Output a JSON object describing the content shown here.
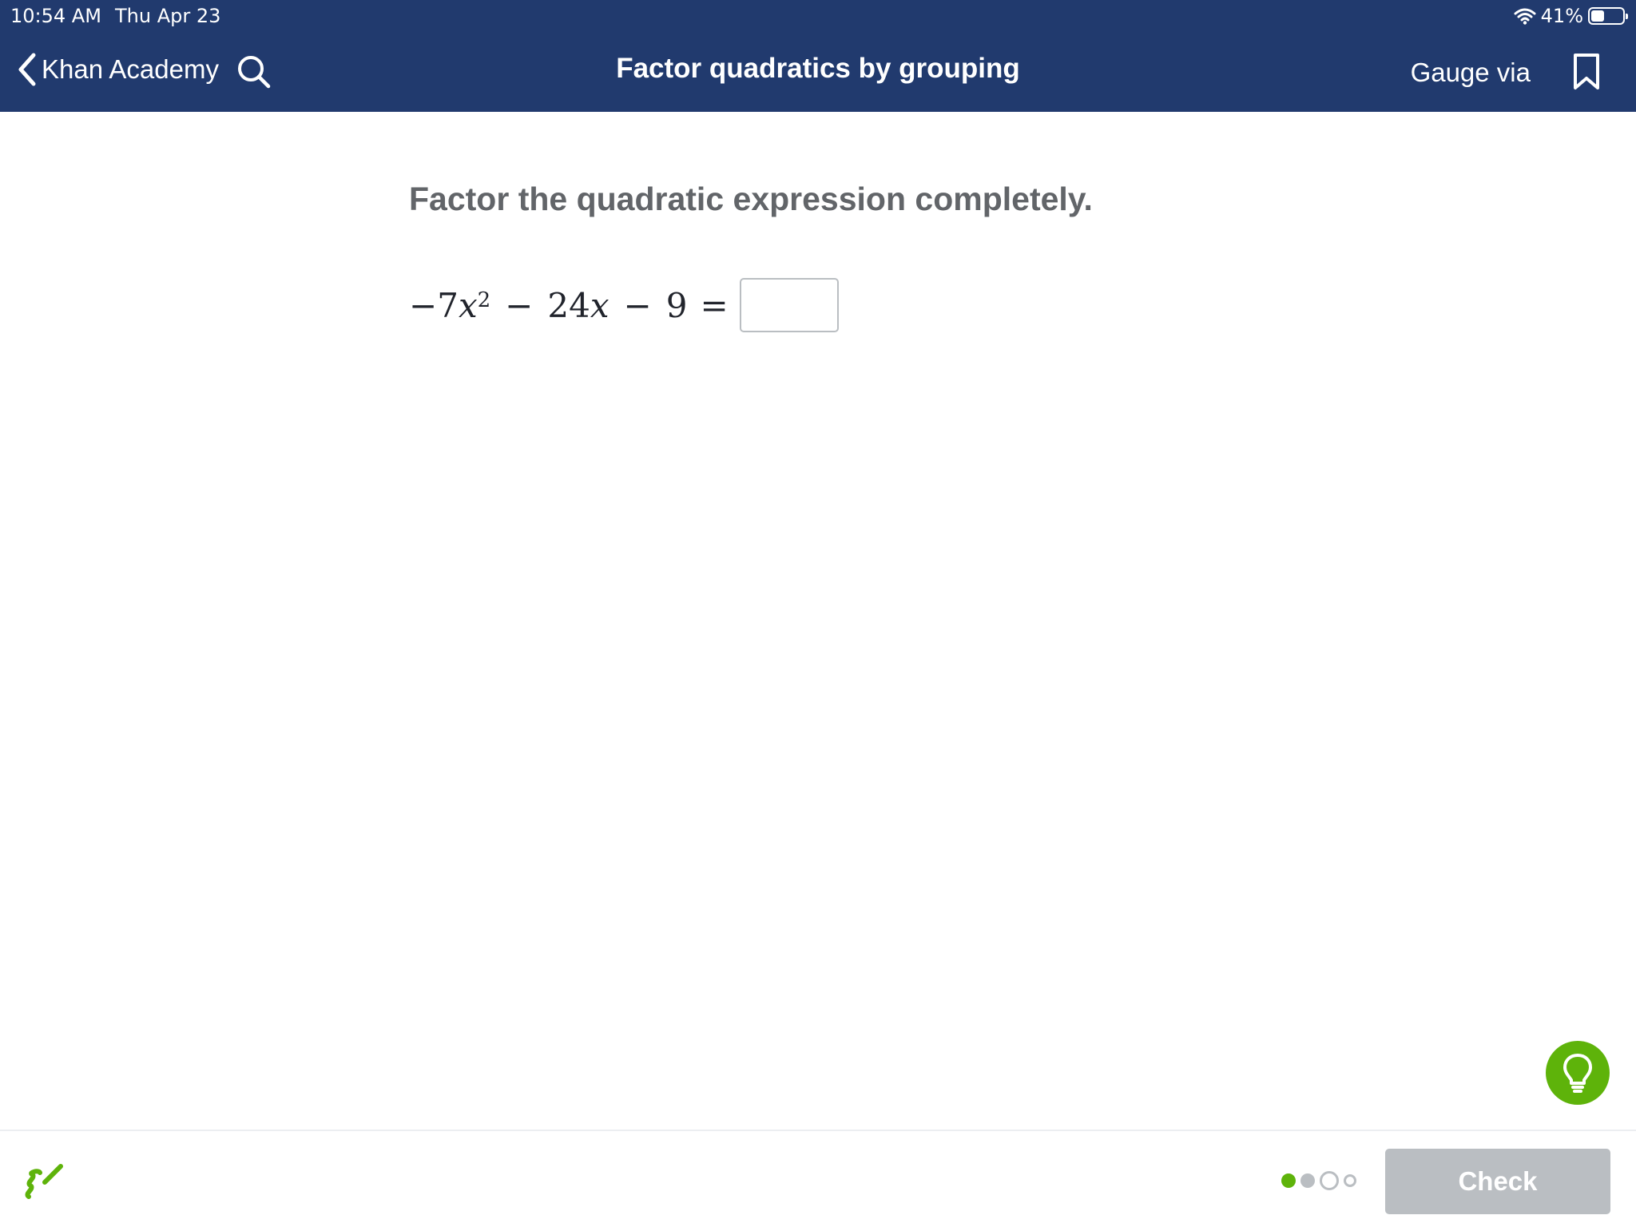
{
  "status_bar": {
    "time": "10:54 AM",
    "date": "Thu Apr 23",
    "battery": "41%",
    "battery_level": 0.41
  },
  "nav": {
    "back_label": "Khan Academy",
    "title": "Factor quadratics by grouping",
    "right_label": "Gauge via",
    "icons": [
      "chevron-left-icon",
      "search-icon",
      "bookmark-icon"
    ]
  },
  "question": {
    "prompt": "Factor the quadratic expression completely.",
    "equation": {
      "minus_sign": "−",
      "coef_a": "7",
      "var": "x",
      "exponent": "2",
      "op1": "−",
      "coef_b": "24",
      "op2": "−",
      "const": "9",
      "equals": "="
    },
    "answer_value": ""
  },
  "footer": {
    "check_label": "Check",
    "progress": [
      "done",
      "next",
      "current",
      "todo"
    ]
  },
  "colors": {
    "nav_bg": "#213a6e",
    "accent_green": "#5eb30a",
    "disabled_gray": "#babec2",
    "prompt_text": "#626569"
  }
}
